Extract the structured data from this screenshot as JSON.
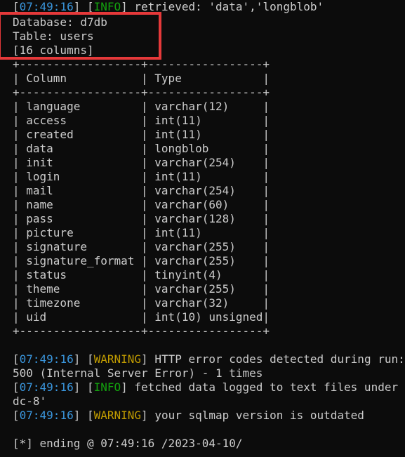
{
  "header_partial": {
    "ts": "07:49:16",
    "level": "INFO",
    "msg": " retrieved: 'data','longblob'"
  },
  "db_info": {
    "database": "Database: d7db",
    "table": "Table: users",
    "columns_count": "[16 columns]"
  },
  "table": {
    "border": "+------------------+-----------------+",
    "header": "| Column           | Type            |",
    "rows": [
      "| language         | varchar(12)     |",
      "| access           | int(11)         |",
      "| created          | int(11)         |",
      "| data             | longblob        |",
      "| init             | varchar(254)    |",
      "| login            | int(11)         |",
      "| mail             | varchar(254)    |",
      "| name             | varchar(60)     |",
      "| pass             | varchar(128)    |",
      "| picture          | int(11)         |",
      "| signature        | varchar(255)    |",
      "| signature_format | varchar(255)    |",
      "| status           | tinyint(4)      |",
      "| theme            | varchar(255)    |",
      "| timezone         | varchar(32)     |",
      "| uid              | int(10) unsigned|"
    ]
  },
  "log": [
    {
      "ts": "07:49:16",
      "level": "WARNING",
      "level_color": "#c19c00",
      "msg": " HTTP error codes detected during run:"
    },
    {
      "cont": "500 (Internal Server Error) - 1 times"
    },
    {
      "ts": "07:49:16",
      "level": "INFO",
      "level_color": "#13a10e",
      "msg": " fetched data logged to text files under"
    },
    {
      "cont": "dc-8'"
    },
    {
      "ts": "07:49:16",
      "level": "WARNING",
      "level_color": "#c19c00",
      "msg": " your sqlmap version is outdated"
    }
  ],
  "ending": "[*] ending @ 07:49:16 /2023-04-10/"
}
